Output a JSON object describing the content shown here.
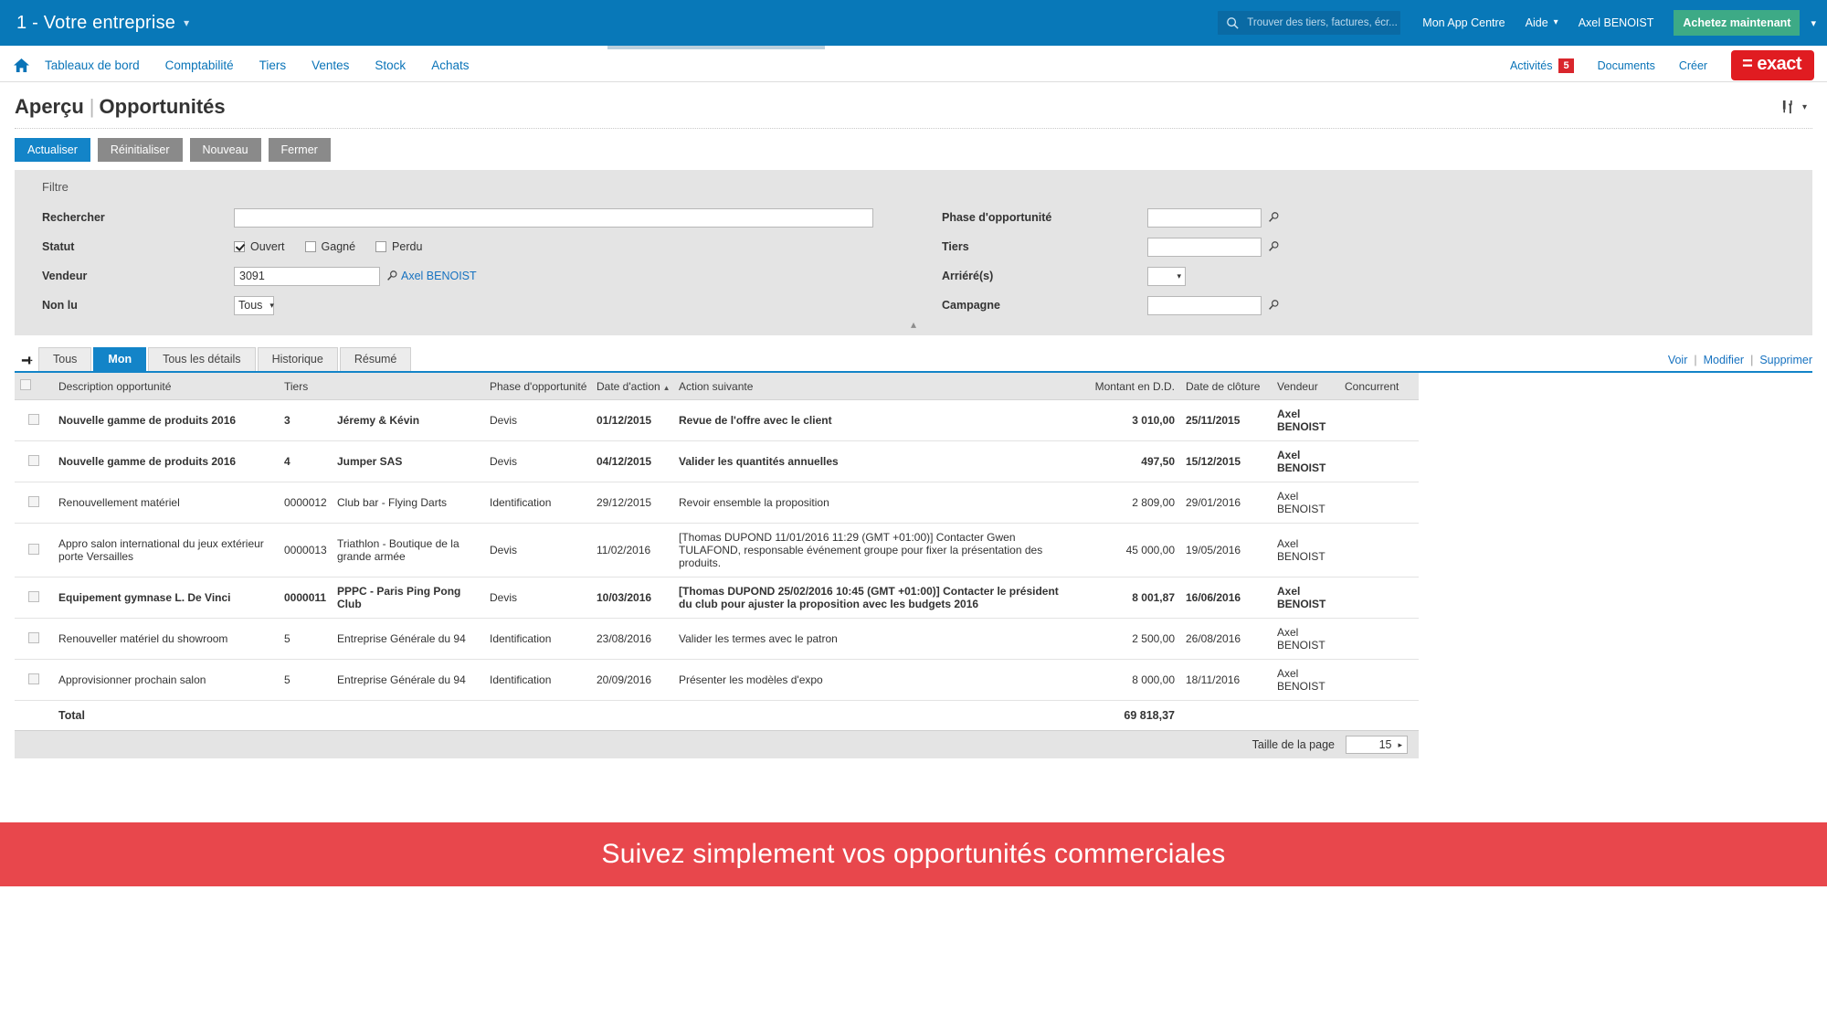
{
  "topbar": {
    "company": "1 - Votre entreprise",
    "search_placeholder": "Trouver des tiers, factures, écr...",
    "links": [
      {
        "label": "Mon App Centre",
        "caret": false
      },
      {
        "label": "Aide",
        "caret": true
      },
      {
        "label": "Axel BENOIST",
        "caret": false
      }
    ],
    "buy_button": "Achetez maintenant",
    "search_icon": "search-icon",
    "colors": {
      "bar": "#0878b8",
      "search_field": "#0a6aa4",
      "buy": "#3daa86"
    }
  },
  "nav": {
    "home_icon": "home-icon",
    "items": [
      "Tableaux de bord",
      "Comptabilité",
      "Tiers",
      "Ventes",
      "Stock",
      "Achats"
    ],
    "right": {
      "activities_label": "Activités",
      "activities_count": "5",
      "documents_label": "Documents",
      "create_label": "Créer",
      "logo_text": "= exact",
      "badge_color": "#d9262c",
      "logo_color": "#e01c21"
    }
  },
  "page": {
    "title_primary": "Aperçu",
    "title_separator": "|",
    "title_secondary": "Opportunités",
    "tools_icon": "tools-settings-icon"
  },
  "actions": {
    "refresh": "Actualiser",
    "reset": "Réinitialiser",
    "new": "Nouveau",
    "close": "Fermer"
  },
  "filter": {
    "legend": "Filtre",
    "search_label": "Rechercher",
    "search_value": "",
    "status_label": "Statut",
    "status_options": [
      {
        "label": "Ouvert",
        "checked": true
      },
      {
        "label": "Gagné",
        "checked": false
      },
      {
        "label": "Perdu",
        "checked": false
      }
    ],
    "vendor_label": "Vendeur",
    "vendor_value": "3091",
    "vendor_name": "Axel BENOIST",
    "unread_label": "Non lu",
    "unread_value": "Tous",
    "phase_label": "Phase d'opportunité",
    "phase_value": "",
    "tiers_label": "Tiers",
    "tiers_value": "",
    "overdue_label": "Arriéré(s)",
    "overdue_value": "",
    "campaign_label": "Campagne",
    "campaign_value": "",
    "lookup_icon": "magnifier-lookup-icon",
    "collapse_icon": "chevron-up-icon"
  },
  "tabs": {
    "pin_icon": "pin-icon",
    "items": [
      {
        "label": "Tous",
        "active": false
      },
      {
        "label": "Mon",
        "active": true
      },
      {
        "label": "Tous les détails",
        "active": false
      },
      {
        "label": "Historique",
        "active": false
      },
      {
        "label": "Résumé",
        "active": false
      }
    ],
    "row_actions": [
      "Voir",
      "Modifier",
      "Supprimer"
    ]
  },
  "table": {
    "columns": [
      "Description opportunité",
      "Tiers",
      "Phase d'opportunité",
      "Date d'action",
      "Action suivante",
      "Montant en D.D.",
      "Date de clôture",
      "Vendeur",
      "Concurrent"
    ],
    "sort_column": "Date d'action",
    "sort_direction": "asc",
    "rows": [
      {
        "description": "Nouvelle gamme de produits 2016",
        "tiers_id": "3",
        "tiers": "Jéremy & Kévin",
        "phase": "Devis",
        "date_action": "01/12/2015",
        "next_action": "Revue de l'offre avec le client",
        "amount": "3 010,00",
        "close_date": "25/11/2015",
        "vendor": "Axel BENOIST",
        "competitor": "",
        "unread": true
      },
      {
        "description": "Nouvelle gamme de produits 2016",
        "tiers_id": "4",
        "tiers": "Jumper SAS",
        "phase": "Devis",
        "date_action": "04/12/2015",
        "next_action": "Valider les quantités annuelles",
        "amount": "497,50",
        "close_date": "15/12/2015",
        "vendor": "Axel BENOIST",
        "competitor": "",
        "unread": true
      },
      {
        "description": "Renouvellement matériel",
        "tiers_id": "0000012",
        "tiers": "Club bar - Flying Darts",
        "phase": "Identification",
        "date_action": "29/12/2015",
        "next_action": "Revoir ensemble la proposition",
        "amount": "2 809,00",
        "close_date": "29/01/2016",
        "vendor": "Axel BENOIST",
        "competitor": "",
        "unread": false
      },
      {
        "description": "Appro salon international du jeux extérieur porte Versailles",
        "tiers_id": "0000013",
        "tiers": "Triathlon - Boutique de la grande armée",
        "phase": "Devis",
        "date_action": "11/02/2016",
        "next_action": "[Thomas DUPOND 11/01/2016 11:29 (GMT +01:00)] Contacter Gwen TULAFOND, responsable événement groupe pour fixer la présentation des produits.",
        "amount": "45 000,00",
        "close_date": "19/05/2016",
        "vendor": "Axel BENOIST",
        "competitor": "",
        "unread": false
      },
      {
        "description": "Equipement gymnase L. De Vinci",
        "tiers_id": "0000011",
        "tiers": "PPPC - Paris Ping Pong Club",
        "phase": "Devis",
        "date_action": "10/03/2016",
        "next_action": "[Thomas DUPOND 25/02/2016 10:45 (GMT +01:00)] Contacter le président du club pour ajuster la proposition avec les budgets 2016",
        "amount": "8 001,87",
        "close_date": "16/06/2016",
        "vendor": "Axel BENOIST",
        "competitor": "",
        "unread": true
      },
      {
        "description": "Renouveller matériel du showroom",
        "tiers_id": "5",
        "tiers": "Entreprise Générale du 94",
        "phase": "Identification",
        "date_action": "23/08/2016",
        "next_action": "Valider les termes avec le patron",
        "amount": "2 500,00",
        "close_date": "26/08/2016",
        "vendor": "Axel BENOIST",
        "competitor": "",
        "unread": false
      },
      {
        "description": "Approvisionner prochain salon",
        "tiers_id": "5",
        "tiers": "Entreprise Générale du 94",
        "phase": "Identification",
        "date_action": "20/09/2016",
        "next_action": "Présenter les modèles d'expo",
        "amount": "8 000,00",
        "close_date": "18/11/2016",
        "vendor": "Axel BENOIST",
        "competitor": "",
        "unread": false
      }
    ],
    "total_label": "Total",
    "total_amount": "69 818,37"
  },
  "footer": {
    "pagesize_label": "Taille de la page",
    "pagesize_value": "15"
  },
  "banner": {
    "text": "Suivez simplement vos opportunités commerciales",
    "color": "#e8474c"
  }
}
